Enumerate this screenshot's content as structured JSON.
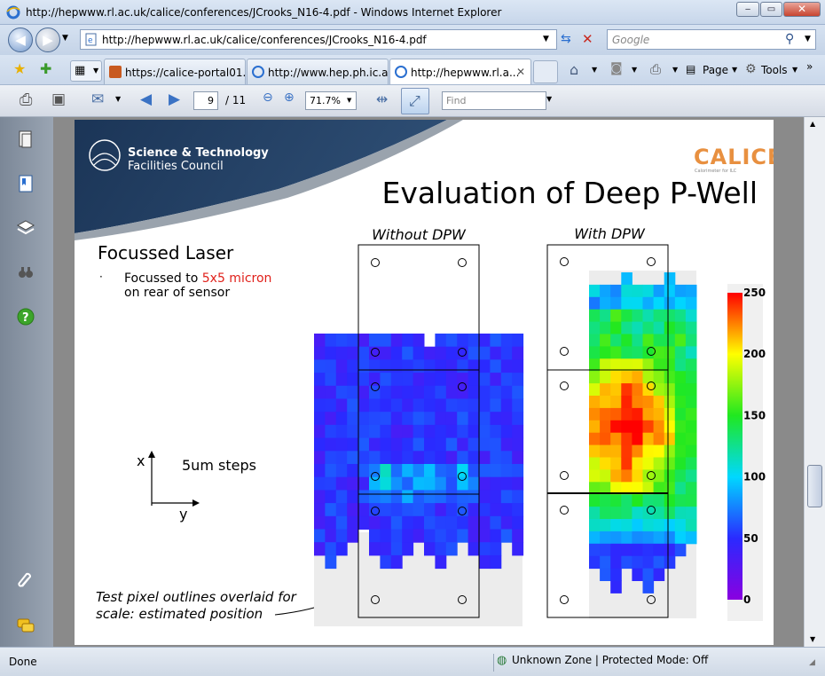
{
  "window": {
    "title": "http://hepwww.rl.ac.uk/calice/conferences/JCrooks_N16-4.pdf - Windows Internet Explorer",
    "minimize": "‒",
    "maximize": "▭",
    "close": "✕"
  },
  "address": {
    "url": "http://hepwww.rl.ac.uk/calice/conferences/JCrooks_N16-4.pdf"
  },
  "search": {
    "placeholder": "Google"
  },
  "tabs": [
    {
      "label": "https://calice-portal01...."
    },
    {
      "label": "http://www.hep.ph.ic.a..."
    },
    {
      "label": "http://hepwww.rl.a..."
    }
  ],
  "commands": {
    "page": "Page",
    "tools": "Tools"
  },
  "pdf_toolbar": {
    "page_current": "9",
    "page_total": "/ 11",
    "zoom": "71.7%",
    "find_placeholder": "Find"
  },
  "slide": {
    "org_line1": "Science & Technology",
    "org_line2": "Facilities Council",
    "logo": "CALICE",
    "logo_sub": "Calorimeter for ILC",
    "title": "Evaluation of Deep P-Well",
    "heading": "Focussed Laser",
    "bullet_prefix": "Focussed to",
    "bullet_highlight": "5x5 micron",
    "bullet_line2": "on rear of sensor",
    "axis_x": "x",
    "axis_y": "y",
    "steps": "5um steps",
    "note_line1": "Test pixel outlines overlaid for",
    "note_line2": "scale: estimated position",
    "map_left_title": "Without DPW",
    "map_right_title": "With DPW",
    "colorbar_ticks": [
      "250",
      "200",
      "150",
      "100",
      "50",
      "0"
    ],
    "highlight_color": "#e0201a",
    "header_color": "#1f3a5f"
  },
  "status": {
    "done": "Done",
    "zone": "Unknown Zone | Protected Mode: Off"
  }
}
